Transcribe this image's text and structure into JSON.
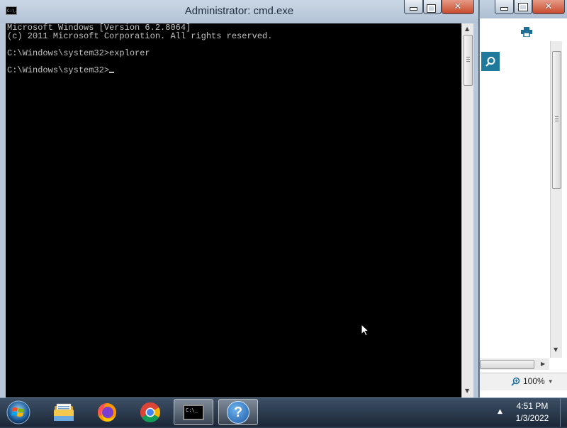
{
  "cmd_window": {
    "title": "Administrator: cmd.exe",
    "sysicon_text": "C:\\.",
    "console_lines": [
      "Microsoft Windows [Version 6.2.8064]",
      "(c) 2011 Microsoft Corporation. All rights reserved.",
      "",
      "C:\\Windows\\system32>explorer",
      "",
      "C:\\Windows\\system32>"
    ],
    "colors": {
      "console_bg": "#000000",
      "console_text": "#c0c0c0"
    }
  },
  "background_window": {
    "zoom_level": "100%",
    "icons": [
      "print-icon",
      "search-icon",
      "zoom-icon"
    ],
    "accent_color": "#1f7a9c"
  },
  "taskbar": {
    "start_icon": "windows-orb-icon",
    "pinned": [
      {
        "name": "file-explorer",
        "icon": "folder-icon"
      },
      {
        "name": "firefox",
        "icon": "firefox-icon"
      },
      {
        "name": "chrome",
        "icon": "chrome-icon"
      },
      {
        "name": "cmd",
        "icon": "cmd-icon",
        "active": true,
        "icon_text": "C:\\_"
      },
      {
        "name": "help",
        "icon": "help-icon",
        "icon_text": "?"
      }
    ],
    "tray_arrow": "▲",
    "clock": {
      "time": "4:51 PM",
      "date": "1/3/2022"
    }
  }
}
